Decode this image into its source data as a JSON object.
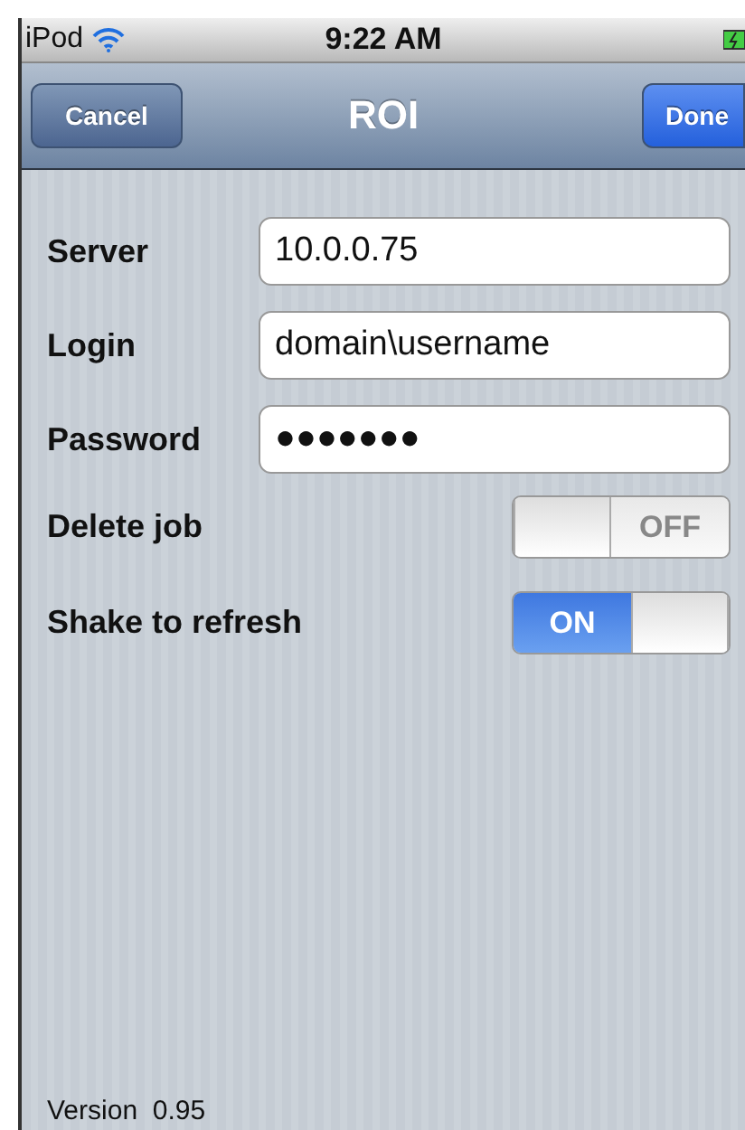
{
  "status_bar": {
    "device": "iPod",
    "time": "9:22 AM"
  },
  "nav_bar": {
    "title": "ROI",
    "left_button": "Cancel",
    "right_button": "Done"
  },
  "fields": [
    {
      "label": "Server",
      "value": "10.0.0.75"
    },
    {
      "label": "Login",
      "value": "domain\\username"
    },
    {
      "label": "Password",
      "value": "●●●●●●●"
    }
  ],
  "switches": [
    {
      "label": "Delete job",
      "on": false,
      "text": "OFF"
    },
    {
      "label": "Shake to refresh",
      "on": true,
      "text": "ON"
    }
  ],
  "footer": "Version  0.95"
}
